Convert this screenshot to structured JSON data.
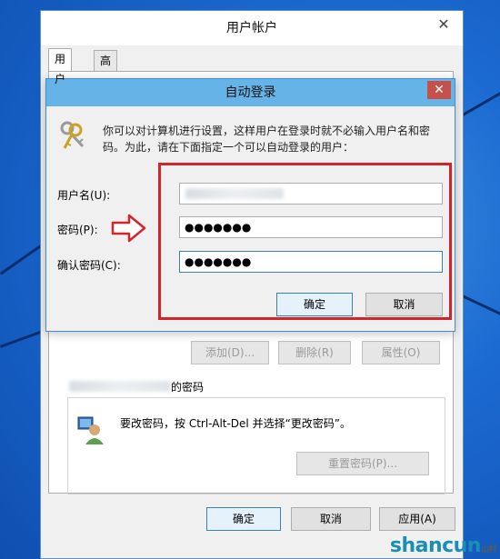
{
  "back_window": {
    "title": "用户帐户",
    "close_glyph": "✕",
    "tabs": [
      {
        "label": "用户"
      },
      {
        "label": "高级"
      }
    ],
    "buttons": {
      "add": "添加(D)...",
      "remove": "删除(R)",
      "properties": "属性(O)"
    },
    "password_group": {
      "title_suffix": "的密码",
      "message": "要改密码，按 Ctrl-Alt-Del 并选择“更改密码”。",
      "reset_button": "重置密码(P)..."
    },
    "footer": {
      "ok": "确定",
      "cancel": "取消",
      "apply": "应用(A)"
    }
  },
  "dialog": {
    "title": "自动登录",
    "close_glyph": "✕",
    "description": "你可以对计算机进行设置，这样用户在登录时就不必输入用户名和密码。为此，请在下面指定一个可以自动登录的用户：",
    "username_label": "用户名(U):",
    "password_label": "密码(P):",
    "confirm_label": "确认密码(C):",
    "password_value": "●●●●●●●",
    "confirm_value": "●●●●●●●",
    "ok": "确定",
    "cancel": "取消"
  },
  "watermark": {
    "text": "shancun",
    "sub": "山村"
  },
  "colors": {
    "highlight": "#d2242b",
    "dialog_title": "#66b3e8",
    "close_red": "#c7504a"
  }
}
